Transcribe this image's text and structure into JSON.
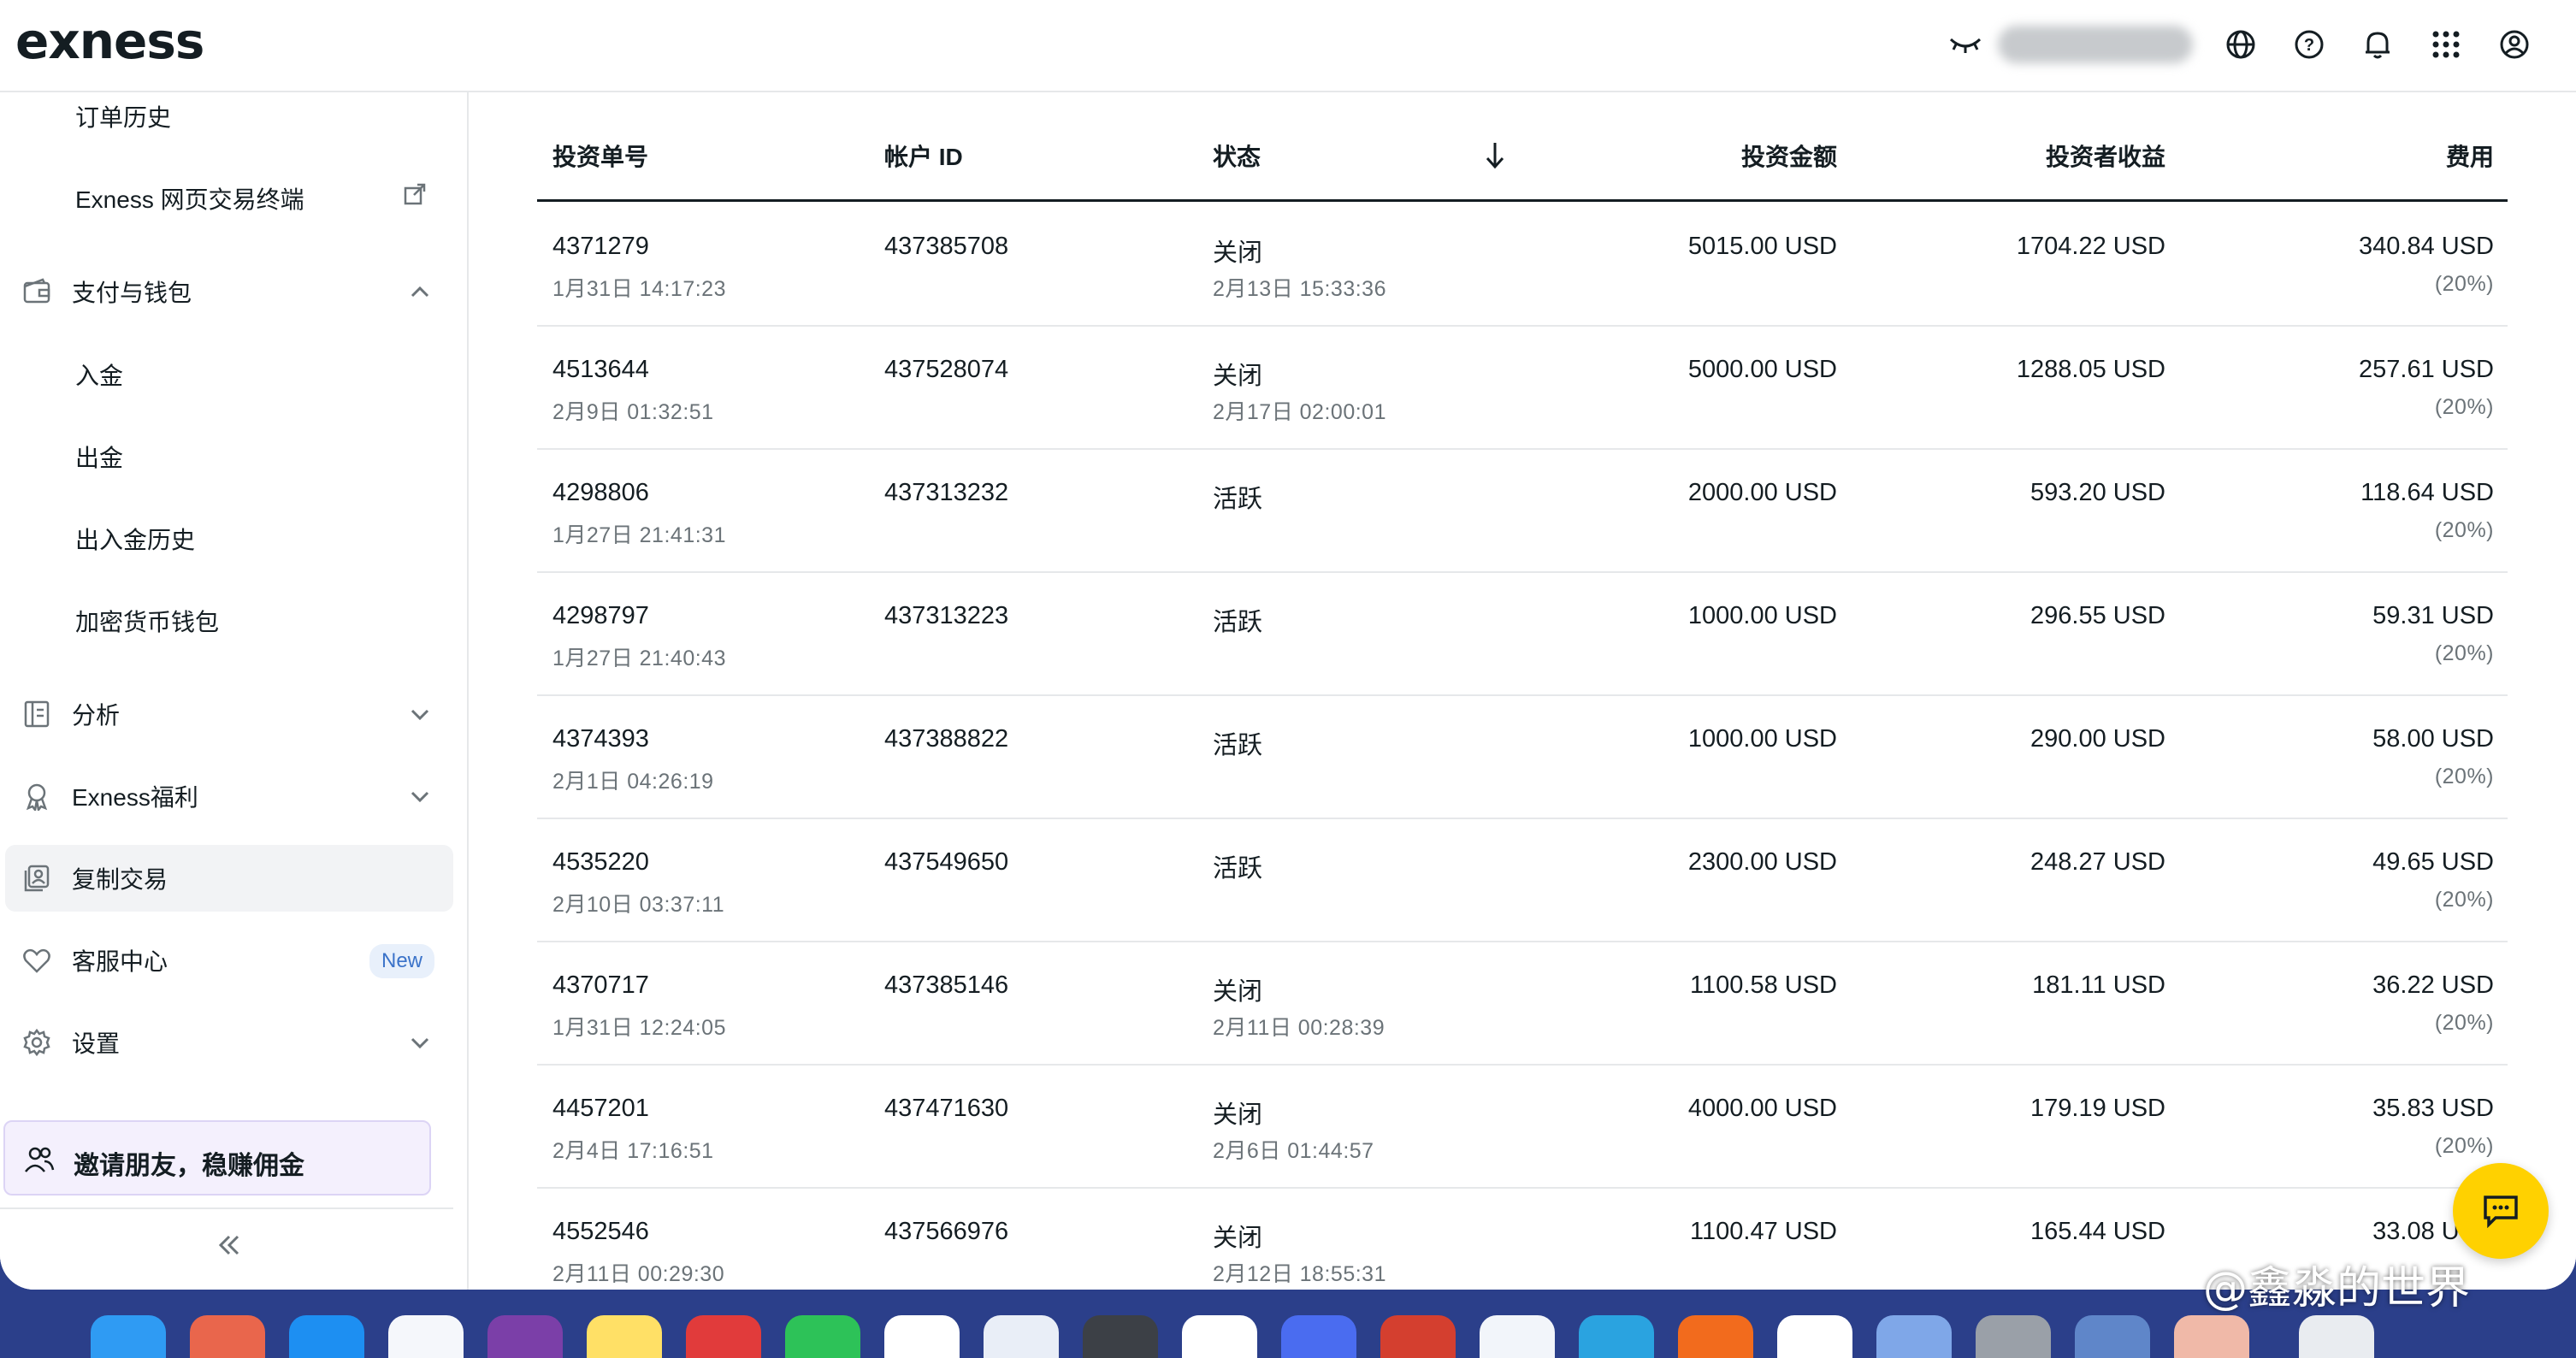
{
  "brand": {
    "logo_text": "exness"
  },
  "topbar": {
    "icons": [
      "hide-balance-icon",
      "globe-icon",
      "help-icon",
      "bell-icon",
      "apps-grid-icon",
      "account-icon"
    ]
  },
  "sidebar": {
    "order_history": "订单历史",
    "web_terminal": "Exness 网页交易终端",
    "payments": "支付与钱包",
    "deposit": "入金",
    "withdraw": "出金",
    "transfer_history": "出入金历史",
    "crypto_wallet": "加密货币钱包",
    "analytics": "分析",
    "benefits": "Exness福利",
    "copy_trading": "复制交易",
    "support": "客服中心",
    "support_badge": "New",
    "settings": "设置",
    "invite": "邀请朋友，稳赚佣金"
  },
  "table": {
    "headers": {
      "investment_id": "投资单号",
      "account_id": "帐户 ID",
      "status": "状态",
      "amount": "投资金额",
      "profit": "投资者收益",
      "fee": "费用"
    },
    "rows": [
      {
        "id": "4371279",
        "opened": "1月31日 14:17:23",
        "account": "437385708",
        "status": "关闭",
        "closed": "2月13日 15:33:36",
        "amount": "5015.00 USD",
        "profit": "1704.22 USD",
        "fee": "340.84 USD",
        "fee_pct": "(20%)"
      },
      {
        "id": "4513644",
        "opened": "2月9日 01:32:51",
        "account": "437528074",
        "status": "关闭",
        "closed": "2月17日 02:00:01",
        "amount": "5000.00 USD",
        "profit": "1288.05 USD",
        "fee": "257.61 USD",
        "fee_pct": "(20%)"
      },
      {
        "id": "4298806",
        "opened": "1月27日 21:41:31",
        "account": "437313232",
        "status": "活跃",
        "closed": "",
        "amount": "2000.00 USD",
        "profit": "593.20 USD",
        "fee": "118.64 USD",
        "fee_pct": "(20%)"
      },
      {
        "id": "4298797",
        "opened": "1月27日 21:40:43",
        "account": "437313223",
        "status": "活跃",
        "closed": "",
        "amount": "1000.00 USD",
        "profit": "296.55 USD",
        "fee": "59.31 USD",
        "fee_pct": "(20%)"
      },
      {
        "id": "4374393",
        "opened": "2月1日 04:26:19",
        "account": "437388822",
        "status": "活跃",
        "closed": "",
        "amount": "1000.00 USD",
        "profit": "290.00 USD",
        "fee": "58.00 USD",
        "fee_pct": "(20%)"
      },
      {
        "id": "4535220",
        "opened": "2月10日 03:37:11",
        "account": "437549650",
        "status": "活跃",
        "closed": "",
        "amount": "2300.00 USD",
        "profit": "248.27 USD",
        "fee": "49.65 USD",
        "fee_pct": "(20%)"
      },
      {
        "id": "4370717",
        "opened": "1月31日 12:24:05",
        "account": "437385146",
        "status": "关闭",
        "closed": "2月11日 00:28:39",
        "amount": "1100.58 USD",
        "profit": "181.11 USD",
        "fee": "36.22 USD",
        "fee_pct": "(20%)"
      },
      {
        "id": "4457201",
        "opened": "2月4日 17:16:51",
        "account": "437471630",
        "status": "关闭",
        "closed": "2月6日 01:44:57",
        "amount": "4000.00 USD",
        "profit": "179.19 USD",
        "fee": "35.83 USD",
        "fee_pct": "(20%)"
      },
      {
        "id": "4552546",
        "opened": "2月11日 00:29:30",
        "account": "437566976",
        "status": "关闭",
        "closed": "2月12日 18:55:31",
        "amount": "1100.47 USD",
        "profit": "165.44 USD",
        "fee": "33.08 USD",
        "fee_pct": ""
      }
    ]
  },
  "watermark": "@鑫淼的世界",
  "colors": {
    "accent_yellow": "#ffd100",
    "dock_bg": "#2b3f8a",
    "copy_highlight": "#f2f3f5",
    "invite_bg": "#f4f0fd"
  }
}
